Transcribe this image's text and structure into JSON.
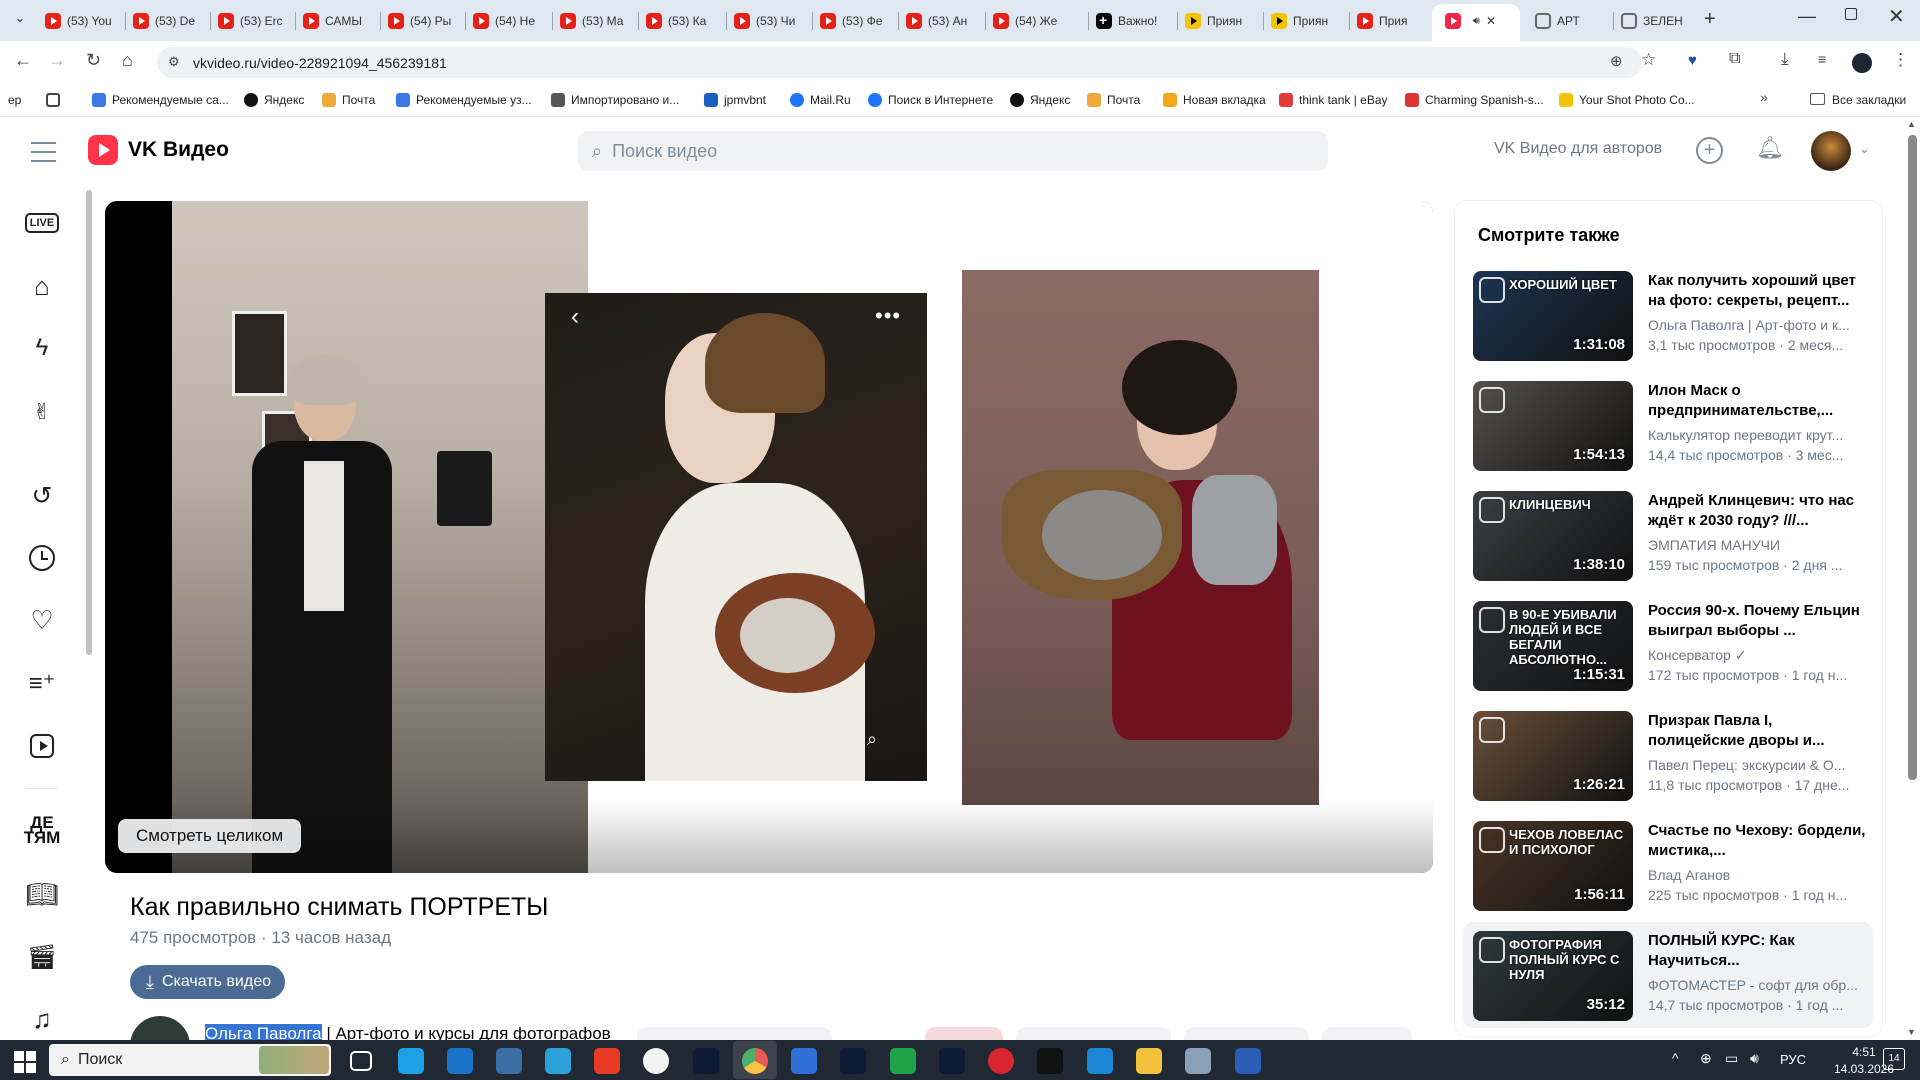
{
  "browser": {
    "tabs": [
      {
        "label": "(53) You",
        "icon": "youtube-icon"
      },
      {
        "label": "(53) De",
        "icon": "youtube-icon"
      },
      {
        "label": "(53) Erc",
        "icon": "youtube-icon"
      },
      {
        "label": "САМЫ",
        "icon": "youtube-icon"
      },
      {
        "label": "(54) Ры",
        "icon": "youtube-icon"
      },
      {
        "label": "(54) Не",
        "icon": "youtube-icon"
      },
      {
        "label": "(53) Ма",
        "icon": "youtube-icon"
      },
      {
        "label": "(53) Ка",
        "icon": "youtube-icon"
      },
      {
        "label": "(53) Чи",
        "icon": "youtube-icon"
      },
      {
        "label": "(53) Фе",
        "icon": "youtube-icon"
      },
      {
        "label": "(53) Ан",
        "icon": "youtube-icon"
      },
      {
        "label": "(54) Же",
        "icon": "youtube-icon"
      },
      {
        "label": "Важно!",
        "icon": "dzen-icon"
      },
      {
        "label": "Приян",
        "icon": "play-yellow-icon"
      },
      {
        "label": "Приян",
        "icon": "play-yellow-icon"
      },
      {
        "label": "Прия",
        "icon": "youtube-icon"
      },
      {
        "label": "",
        "icon": "vk-video-icon",
        "active": true
      },
      {
        "label": "АРТ",
        "icon": "globe-icon"
      },
      {
        "label": "ЗЕЛЕН",
        "icon": "globe-icon"
      }
    ],
    "url": "vkvideo.ru/video-228921094_456239181",
    "bookmarks": [
      {
        "label": "ер",
        "icon": ""
      },
      {
        "label": "",
        "icon": "apps-icon"
      },
      {
        "label": "Рекомендуемые са...",
        "icon": "search-icon"
      },
      {
        "label": "Яндекс",
        "icon": "plus-icon"
      },
      {
        "label": "Почта",
        "icon": "mail-icon"
      },
      {
        "label": "Рекомендуемые уз...",
        "icon": "search-icon"
      },
      {
        "label": "Импортировано и...",
        "icon": "folder-icon"
      },
      {
        "label": "jpmvbnt",
        "icon": "bookmark-icon"
      },
      {
        "label": "Mail.Ru",
        "icon": "at-icon"
      },
      {
        "label": "Поиск в Интернете",
        "icon": "at-icon"
      },
      {
        "label": "Яндекс",
        "icon": "plus-icon"
      },
      {
        "label": "Почта",
        "icon": "mail-icon"
      },
      {
        "label": "Новая вкладка",
        "icon": "home-icon"
      },
      {
        "label": "think tank | eBay",
        "icon": "bag-icon"
      },
      {
        "label": "Charming Spanish-s...",
        "icon": "triangle-icon"
      },
      {
        "label": "Your Shot Photo Co...",
        "icon": "photo-icon"
      }
    ],
    "all_bookmarks": "Все закладки"
  },
  "vk": {
    "logo": "VK Видео",
    "search_placeholder": "Поиск видео",
    "for_authors": "VK Видео для авторов",
    "left_nav": [
      "live-icon",
      "home-icon",
      "shorts-icon",
      "hand-icon",
      "history-icon",
      "clock-icon",
      "heart-icon",
      "playlist-add-icon",
      "my-videos-icon",
      "kids-icon",
      "book-icon",
      "films-icon",
      "music-icon"
    ]
  },
  "video": {
    "watch_full": "Смотреть целиком",
    "title": "Как правильно снимать ПОРТРЕТЫ",
    "views": "475 просмотров",
    "time_ago": "13 часов назад",
    "download": "Скачать видео",
    "author_selected": "Ольга Паволга",
    "author_rest": " | Арт-фото и курсы для фотографов"
  },
  "sidebar": {
    "heading": "Смотрите также",
    "items": [
      {
        "title": "Как получить хороший цвет на фото: секреты, рецепт...",
        "author": "Ольга Паволга | Арт-фото и к...",
        "stats": "3,1 тыс просмотров · 2 меся...",
        "duration": "1:31:08",
        "thumb_text": "ХОРОШИЙ ЦВЕТ",
        "color": "#1c3553"
      },
      {
        "title": "Илон Маск о предпринимательстве,...",
        "author": "Калькулятор переводит крут...",
        "stats": "14,4 тыс просмотров · 3 мес...",
        "duration": "1:54:13",
        "thumb_text": "",
        "color": "#55504b"
      },
      {
        "title": "Андрей Клинцевич: что нас ждёт к 2030 году? ///...",
        "author": "ЭМПАТИЯ МАНУЧИ",
        "stats": "159 тыс просмотров · 2 дня ...",
        "duration": "1:38:10",
        "thumb_text": "КЛИНЦЕВИЧ",
        "color": "#3b3f45"
      },
      {
        "title": "Россия 90-х. Почему Ельцин выиграл выборы ...",
        "author": "Консерватор ✓",
        "stats": "172 тыс просмотров · 1 год н...",
        "duration": "1:15:31",
        "thumb_text": "В 90-Е УБИВАЛИ ЛЮДЕЙ И ВСЕ БЕГАЛИ АБСОЛЮТНО...",
        "color": "#2a2f36"
      },
      {
        "title": "Призрак Павла I, полицейские дворы и...",
        "author": "Павел Перец: экскурсии & О...",
        "stats": "11,8 тыс просмотров · 17 дне...",
        "duration": "1:26:21",
        "thumb_text": "",
        "color": "#6a4f3a"
      },
      {
        "title": "Счастье по Чехову: бордели, мистика,...",
        "author": "Влад Аганов",
        "stats": "225 тыс просмотров · 1 год н...",
        "duration": "1:56:11",
        "thumb_text": "ЧЕХОВ ЛОВЕЛАС И ПСИХОЛОГ",
        "color": "#4a3426"
      },
      {
        "title": "ПОЛНЫЙ КУРС: Как Научиться...",
        "author": "ФОТОМАСТЕР - софт для обр...",
        "stats": "14,7 тыс просмотров · 1 год ...",
        "duration": "35:12",
        "thumb_text": "ФОТОГРАФИЯ ПОЛНЫЙ КУРС С НУЛЯ",
        "color": "#2d3a3f"
      }
    ]
  },
  "taskbar": {
    "search": "Поиск",
    "lang": "РУС",
    "time": "4:51",
    "date": "14.03.2026",
    "notif": "14"
  }
}
